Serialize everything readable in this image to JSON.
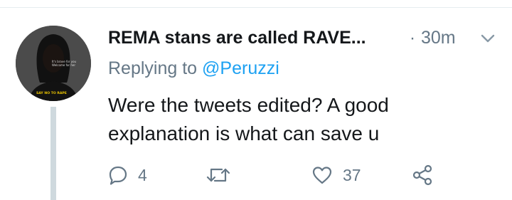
{
  "tweet": {
    "display_name": "REMA stans are called RAVE...",
    "separator": "·",
    "time": "30m",
    "replying_prefix": "Replying to ",
    "replying_handle": "@Peruzzi",
    "text": "Were the tweets edited? A good explanation is what can save u",
    "avatar": {
      "caption_line1": "It's brave for you",
      "caption_line2": "Welcome for her",
      "slogan": "SAY NO TO RAPE"
    }
  },
  "actions": {
    "reply_count": "4",
    "retweet_count": "",
    "like_count": "37"
  },
  "colors": {
    "name": "#14171a",
    "muted": "#657786",
    "link": "#1da1f2",
    "thread": "#cfd9de"
  },
  "icons": [
    "caret-down-icon",
    "reply-icon",
    "retweet-icon",
    "like-icon",
    "share-icon"
  ]
}
